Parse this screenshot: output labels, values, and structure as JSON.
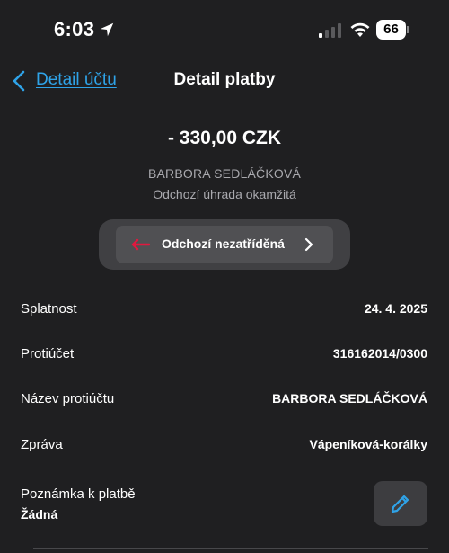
{
  "status_bar": {
    "time": "6:03",
    "battery": "66",
    "icons": [
      "location-arrow-icon",
      "cellular-signal-icon",
      "wifi-icon",
      "battery-icon"
    ]
  },
  "nav": {
    "back_label": "Detail účtu",
    "title": "Detail platby"
  },
  "payment": {
    "amount": "- 330,00 CZK",
    "counterparty": "BARBORA SEDLÁČKOVÁ",
    "type": "Odchozí úhrada okamžitá"
  },
  "category": {
    "label": "Odchozí nezatříděná",
    "icon": "outgoing-arrow-icon",
    "icon_color": "#e0193f"
  },
  "details": [
    {
      "label": "Splatnost",
      "value": "24. 4. 2025"
    },
    {
      "label": "Protiúčet",
      "value": "316162014/0300"
    },
    {
      "label": "Název protiúčtu",
      "value": "BARBORA SEDLÁČKOVÁ"
    },
    {
      "label": "Zpráva",
      "value": "Vápeníková-korálky"
    }
  ],
  "note": {
    "label": "Poznámka k platbě",
    "value": "Žádná",
    "edit_icon": "pencil-icon"
  },
  "colors": {
    "background": "#1f1f21",
    "accent": "#2fa3e8",
    "muted_text": "#a9a9ae"
  }
}
